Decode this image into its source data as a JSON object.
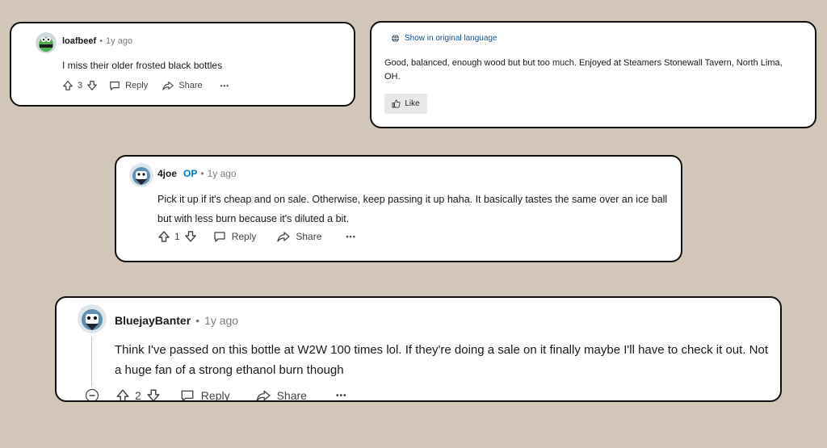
{
  "comments": [
    {
      "username": "loafbeef",
      "time": "1y ago",
      "text": "I miss their older frosted black bottles",
      "votes": "3",
      "reply_label": "Reply",
      "share_label": "Share",
      "more_label": "•••"
    },
    {
      "username": "4joe",
      "op_label": "OP",
      "time": "1y ago",
      "text": "Pick it up if it's cheap and on sale. Otherwise, keep passing it up haha. It basically tastes the same over an ice ball but with less burn because it's diluted a bit.",
      "votes": "1",
      "reply_label": "Reply",
      "share_label": "Share",
      "more_label": "•••"
    },
    {
      "username": "BluejayBanter",
      "time": "1y ago",
      "text": "Think I've passed on this bottle at W2W 100 times lol. If they're doing a sale on it finally maybe I'll have to check it out. Not a huge fan of a strong ethanol burn though",
      "votes": "2",
      "reply_label": "Reply",
      "share_label": "Share",
      "more_label": "•••"
    }
  ],
  "translated": {
    "link_label": "Show in original language",
    "text": "Good, balanced, enough wood but but too much. Enjoyed at Steamers Stonewall Tavern, North Lima, OH.",
    "like_label": "Like"
  },
  "separator": "•",
  "colors": {
    "background": "#d1c6b8",
    "card": "#ffffff",
    "border": "#111111",
    "op_blue": "#0079d3",
    "meta_gray": "#7c7c7c"
  }
}
